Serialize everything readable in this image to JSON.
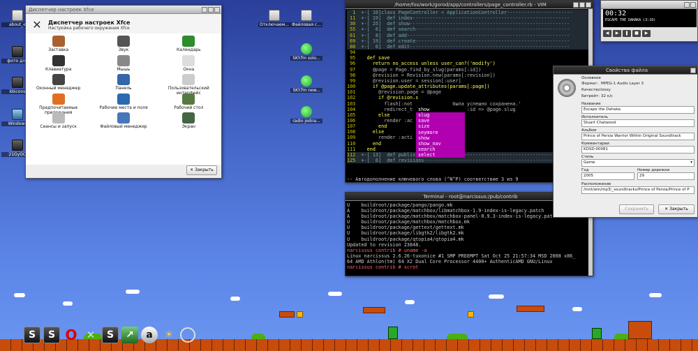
{
  "desktop_icons": [
    {
      "label": "about_e",
      "type": "doc"
    },
    {
      "label": "фото для",
      "type": "dark"
    },
    {
      "label": "kbicons",
      "type": "dark"
    },
    {
      "label": "Windows",
      "type": "net"
    },
    {
      "label": "21GyGO",
      "type": "dark"
    },
    {
      "label": "Отключаем...",
      "type": "doc"
    },
    {
      "label": "Файловая с...",
      "type": "doc"
    },
    {
      "label": "SKY.fm solo...",
      "type": "green"
    },
    {
      "label": "SKY.fm new...",
      "type": "green"
    },
    {
      "label": "radio jedna...",
      "type": "green"
    }
  ],
  "settings": {
    "title": "Диспетчер настроек Xfce",
    "heading": "Диспетчер настроек Xfce",
    "subheading": "Настройка рабочего окружения Xfce",
    "items": [
      {
        "label": "Заставка",
        "icon": "screensaver-icon",
        "color": "#a86030"
      },
      {
        "label": "Звук",
        "icon": "speaker-icon",
        "color": "#555555"
      },
      {
        "label": "Календарь",
        "icon": "calendar-icon",
        "color": "#2e8b2e"
      },
      {
        "label": "Клавиатура",
        "icon": "keyboard-icon",
        "color": "#333333"
      },
      {
        "label": "Мышь",
        "icon": "mouse-icon",
        "color": "#888888"
      },
      {
        "label": "Окна",
        "icon": "windows-icon",
        "color": "#dddddd"
      },
      {
        "label": "Оконный менеджер",
        "icon": "window-manager-icon",
        "color": "#444444"
      },
      {
        "label": "Панель",
        "icon": "panel-icon",
        "color": "#3366aa"
      },
      {
        "label": "Пользовательский интерфейс",
        "icon": "ui-icon",
        "color": "#cccccc"
      },
      {
        "label": "Предпочитаемые приложения",
        "icon": "preferred-apps-icon",
        "color": "#e07020"
      },
      {
        "label": "Рабочие места и поля",
        "icon": "workspaces-icon",
        "color": "#2a6ab0"
      },
      {
        "label": "Рабочий стол",
        "icon": "desktop-icon",
        "color": "#557a40"
      },
      {
        "label": "Сеансы и запуск",
        "icon": "sessions-icon",
        "color": "#bbbbbb"
      },
      {
        "label": "Файловый менеджер",
        "icon": "file-manager-icon",
        "color": "#4477bb"
      },
      {
        "label": "Экран",
        "icon": "display-icon",
        "color": "#446644"
      }
    ],
    "close_label": "Закрыть"
  },
  "vim": {
    "title": "/home/fox/work/gorod/app/controllers/page_controller.rb - VIM",
    "lines": [
      {
        "n": " 1",
        "kind": "fold",
        "text": "+-[ 10]class PageController < ApplicationController-----------------------"
      },
      {
        "n": "11",
        "kind": "fold",
        "text": "+-[ 19]  def index-------------------------------------------------------"
      },
      {
        "n": "30",
        "kind": "fold",
        "text": "+-[ 25]  def show--------------------------------------------------------"
      },
      {
        "n": "55",
        "kind": "fold",
        "text": "+-[  6]  def search------------------------------------------------------"
      },
      {
        "n": "61",
        "kind": "fold",
        "text": "+-[  8]  def add---------------------------------------------------------"
      },
      {
        "n": "69",
        "kind": "fold",
        "text": "+-[ 19]  def create------------------------------------------------------"
      },
      {
        "n": "88",
        "kind": "fold",
        "text": "+-[  6]  def edit--------------------------------------------------------"
      },
      {
        "n": "94",
        "kind": "code",
        "text": ""
      },
      {
        "n": "95",
        "kind": "code",
        "text": "  def save"
      },
      {
        "n": "96",
        "kind": "code",
        "text": "    return no_access unless user_can?('modify')"
      },
      {
        "n": "97",
        "kind": "code",
        "text": "    @page = Page.find_by_slug(params[:id])"
      },
      {
        "n": "98",
        "kind": "code",
        "text": "    @revision = Revision.new(params[:revision])"
      },
      {
        "n": "99",
        "kind": "code",
        "text": "    @revision.user = session[:user]"
      },
      {
        "n": "100",
        "kind": "code",
        "text": "    if @page.update_attributes(params[:page])"
      },
      {
        "n": "101",
        "kind": "code",
        "text": "      @revision.page = @page"
      },
      {
        "n": "102",
        "kind": "code",
        "text": "      if @revision.s"
      },
      {
        "n": "103",
        "kind": "code",
        "text": "        flash[:not              была успешно сохранена.'"
      },
      {
        "n": "104",
        "kind": "code",
        "text": "        redirect_t              ow', :id => @page.slug"
      },
      {
        "n": "105",
        "kind": "code",
        "text": "      else"
      },
      {
        "n": "106",
        "kind": "code",
        "text": "        render :ac"
      },
      {
        "n": "107",
        "kind": "code",
        "text": "      end"
      },
      {
        "n": "108",
        "kind": "code",
        "text": "    else"
      },
      {
        "n": "109",
        "kind": "code",
        "text": "      render :acti"
      },
      {
        "n": "110",
        "kind": "code",
        "text": "    end"
      },
      {
        "n": "111",
        "kind": "code",
        "text": "  end"
      },
      {
        "n": "112",
        "kind": "fold",
        "text": "+-[ 13]  def publish-----------------------------------------------------"
      },
      {
        "n": "125",
        "kind": "fold",
        "text": "+-[  6]  def revisions---------------------------------------------------"
      }
    ],
    "popup": [
      "show",
      "slug",
      "save",
      "size",
      "seymore",
      "show",
      "show_nav",
      "search",
      "select"
    ],
    "popup_selected": 0,
    "status": "-- Автодополнение ключевого слова (^N^P) соответствие 3 из 9"
  },
  "terminal": {
    "title": "Terminal - root@narcissus:/pub/contrib",
    "lines": [
      {
        "t": "U    buildroot/package/pango/pango.mk",
        "p": false
      },
      {
        "t": "A    buildroot/package/matchbox/libmatchbox-1.9-index-is-legacy.patch",
        "p": false
      },
      {
        "t": "A    buildroot/package/matchbox/matchbox-panel-0.9.3-index-is-legacy.patch",
        "p": false
      },
      {
        "t": "U    buildroot/package/matchbox/matchbox.mk",
        "p": false
      },
      {
        "t": "U    buildroot/package/gettext/gettext.mk",
        "p": false
      },
      {
        "t": "U    buildroot/package/libgtk2/libgtk2.mk",
        "p": false
      },
      {
        "t": "U    buildroot/package/qtopia4/qtopia4.mk",
        "p": false
      },
      {
        "t": "Updated to revision 23848.",
        "p": false
      },
      {
        "t": "narcissus contrib # uname -a",
        "p": true
      },
      {
        "t": "Linux narcissus 2.6.26-tuxonice #1 SMP PREEMPT Sat Oct 25 21:57:34 MSD 2008 x86_",
        "p": false
      },
      {
        "t": "64 AMD Athlon(tm) 64 X2 Dual Core Processor 4400+ AuthenticAMD GNU/Linux",
        "p": false
      },
      {
        "t": "narcissus contrib # scrot",
        "p": true
      }
    ]
  },
  "player": {
    "time": "00:32",
    "track": "ESCAPE THE DAHAKA (3:10)"
  },
  "tags": {
    "title": "Свойства файла",
    "section_main": "Основное",
    "format_label": "Формат:",
    "format_value": "MPEG-1 Audio Layer 3",
    "quality_label": "Качество:",
    "quality_value": "lossy",
    "bitrate_label": "Битрейт:",
    "bitrate_value": "32 к/с",
    "title_label": "Название",
    "title_value": "Escape the Dahaka",
    "artist_label": "Исполнитель",
    "artist_value": "Stuart Chatwood",
    "album_label": "Альбом",
    "album_value": "Prince of Persia Warrior Within Original Soundtrack",
    "comment_label": "Комментарии",
    "comment_value": "KDSD-00081",
    "genre_label": "Стиль",
    "genre_value": "Game",
    "year_label": "Год",
    "year_value": "2005",
    "track_label": "Номер дорожки",
    "track_value": "29",
    "location_label": "Расположение",
    "location_value": "/mnt/win/mp3/_soundtracks/Prince of Persia/Prince of P",
    "save_label": "Сохранить",
    "close_label": "Закрыть"
  },
  "taskbar": [
    {
      "name": "taskbar-s-1",
      "glyph": "S"
    },
    {
      "name": "taskbar-s-2",
      "glyph": "S"
    },
    {
      "name": "taskbar-opera",
      "glyph": "O"
    },
    {
      "name": "taskbar-tools",
      "glyph": "✕"
    },
    {
      "name": "taskbar-s-3",
      "glyph": "S"
    },
    {
      "name": "taskbar-arrow",
      "glyph": "↗"
    },
    {
      "name": "taskbar-flag",
      "glyph": "a"
    },
    {
      "name": "taskbar-weather",
      "glyph": "☀"
    },
    {
      "name": "taskbar-clock",
      "glyph": ""
    }
  ]
}
